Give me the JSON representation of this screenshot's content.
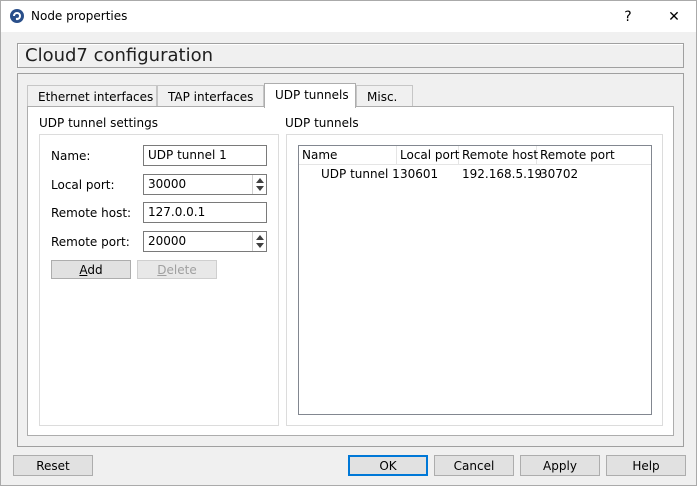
{
  "window": {
    "title": "Node properties",
    "help_glyph": "?",
    "close_glyph": "✕",
    "icon": "gns3-app-icon"
  },
  "config": {
    "title": "Cloud7 configuration"
  },
  "tabs": [
    {
      "label": "Ethernet interfaces",
      "active": false
    },
    {
      "label": "TAP interfaces",
      "active": false
    },
    {
      "label": "UDP tunnels",
      "active": true
    },
    {
      "label": "Misc.",
      "active": false
    }
  ],
  "settings": {
    "group_title": "UDP tunnel settings",
    "name_label": "Name:",
    "name_value": "UDP tunnel 1",
    "local_port_label": "Local port:",
    "local_port_value": "30000",
    "remote_host_label": "Remote host:",
    "remote_host_value": "127.0.0.1",
    "remote_port_label": "Remote port:",
    "remote_port_value": "20000",
    "add_label": "Add",
    "delete_label": "Delete"
  },
  "tunnels": {
    "group_title": "UDP tunnels",
    "columns": [
      "Name",
      "Local port",
      "Remote host",
      "Remote port"
    ],
    "rows": [
      {
        "name": "UDP tunnel 1",
        "local_port": "30601",
        "remote_host": "192.168.5.19",
        "remote_port": "30702"
      }
    ]
  },
  "footer": {
    "reset": "Reset",
    "ok": "OK",
    "cancel": "Cancel",
    "apply": "Apply",
    "help": "Help"
  },
  "colors": {
    "accent": "#0078d7",
    "window_bg": "#f0f0f0",
    "panel_bg": "#ffffff"
  }
}
